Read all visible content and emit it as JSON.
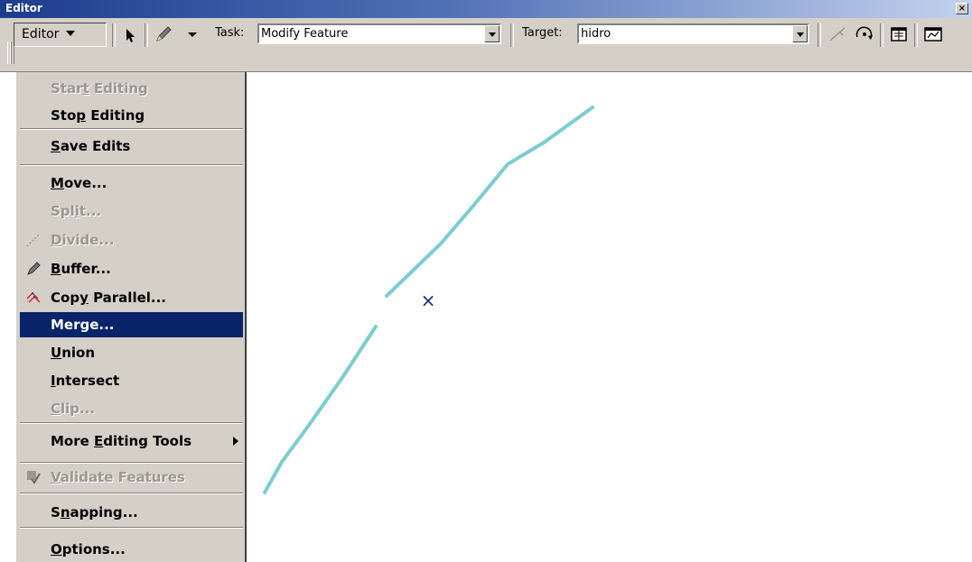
{
  "window": {
    "title": "Editor",
    "close_glyph": "×"
  },
  "toolbar": {
    "editor_menu_label": "Editor",
    "task_label": "Task:",
    "task_value": "Modify Feature",
    "target_label": "Target:",
    "target_value": "hidro",
    "icons": [
      "edit-tool-arrow-icon",
      "sketch-pencil-icon",
      "dropdown-arrow-icon",
      "split-tool-icon",
      "rotate-tool-icon",
      "attributes-icon",
      "sketch-properties-icon"
    ]
  },
  "menu": {
    "items": [
      {
        "pre": "Star",
        "ul": "t",
        "post": " Editing",
        "state": "disabled"
      },
      {
        "pre": "Sto",
        "ul": "p",
        "post": " Editing",
        "state": "normal"
      },
      {
        "pre": "",
        "ul": "S",
        "post": "ave Edits",
        "state": "normal"
      },
      {
        "pre": "",
        "ul": "M",
        "post": "ove...",
        "state": "normal"
      },
      {
        "pre": "Spl",
        "ul": "i",
        "post": "t...",
        "state": "disabled"
      },
      {
        "pre": "",
        "ul": "D",
        "post": "ivide...",
        "state": "disabled",
        "icon": "divide-icon"
      },
      {
        "pre": "",
        "ul": "B",
        "post": "uffer...",
        "state": "normal",
        "icon": "buffer-pencil-icon"
      },
      {
        "pre": "Cop",
        "ul": "y",
        "post": " Parallel...",
        "state": "normal",
        "icon": "copy-parallel-icon"
      },
      {
        "pre": "Merge...",
        "ul": "",
        "post": "",
        "state": "selected"
      },
      {
        "pre": "",
        "ul": "U",
        "post": "nion",
        "state": "normal"
      },
      {
        "pre": "",
        "ul": "I",
        "post": "ntersect",
        "state": "normal"
      },
      {
        "pre": "",
        "ul": "C",
        "post": "lip...",
        "state": "disabled"
      },
      {
        "pre": "More ",
        "ul": "E",
        "post": "diting Tools",
        "state": "normal",
        "submenu": true
      },
      {
        "pre": "",
        "ul": "V",
        "post": "alidate Features",
        "state": "disabled",
        "icon": "validate-features-icon"
      },
      {
        "pre": "S",
        "ul": "n",
        "post": "apping...",
        "state": "normal"
      },
      {
        "pre": "",
        "ul": "O",
        "post": "ptions...",
        "state": "normal"
      }
    ]
  },
  "map": {
    "line_color": "#7ccdd0",
    "cursor_color": "#1a2a7a",
    "cursor_glyph": "×"
  }
}
